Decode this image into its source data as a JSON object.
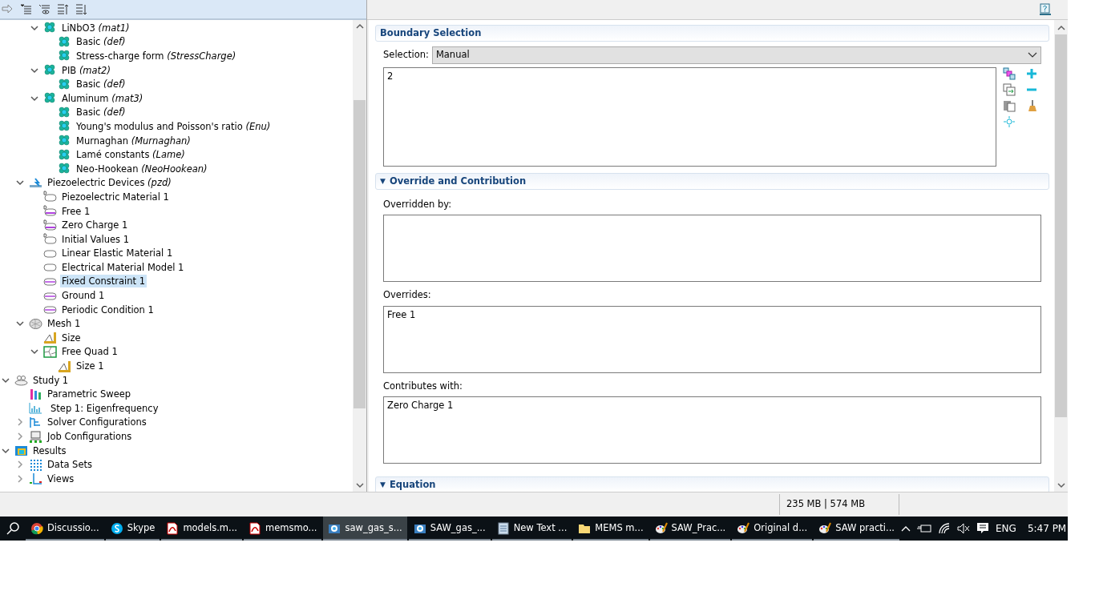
{
  "tree": [
    {
      "children": [
        {
          "children": [
            {
              "label": "LiNbO3 *(mat1)*",
              "kind": "material",
              "expanded": true,
              "selected": false,
              "children": [
                {
                  "label": "Basic *(def)*",
                  "kind": "material",
                  "selected": false
                },
                {
                  "label": "Stress-charge form *(StressCharge)*",
                  "kind": "material",
                  "selected": false
                }
              ]
            },
            {
              "label": "PIB *(mat2)*",
              "kind": "material",
              "expanded": true,
              "selected": false,
              "children": [
                {
                  "label": "Basic *(def)*",
                  "kind": "material",
                  "selected": false
                }
              ]
            },
            {
              "label": "Aluminum *(mat3)*",
              "kind": "material",
              "expanded": true,
              "selected": false,
              "children": [
                {
                  "label": "Basic *(def)*",
                  "kind": "material",
                  "selected": false
                },
                {
                  "label": "Young's modulus and Poisson's ratio *(Enu)*",
                  "kind": "material",
                  "selected": false
                },
                {
                  "label": "Murnaghan *(Murnaghan)*",
                  "kind": "material",
                  "selected": false
                },
                {
                  "label": "Lamé constants *(Lame)*",
                  "kind": "material",
                  "selected": false
                },
                {
                  "label": "Neo-Hookean *(NeoHookean)*",
                  "kind": "material",
                  "selected": false
                }
              ]
            }
          ]
        },
        {
          "label": "Piezoelectric Devices *(pzd)*",
          "kind": "physics",
          "expanded": true,
          "selected": false,
          "children": [
            {
              "label": "Piezoelectric Material 1",
              "kind": "default",
              "selected": false
            },
            {
              "label": "Free 1",
              "kind": "default-boundary",
              "selected": false
            },
            {
              "label": "Zero Charge 1",
              "kind": "default-boundary",
              "selected": false
            },
            {
              "label": "Initial Values 1",
              "kind": "default",
              "selected": false
            },
            {
              "label": "Linear Elastic Material 1",
              "kind": "domain",
              "selected": false
            },
            {
              "label": "Electrical Material Model 1",
              "kind": "domain",
              "selected": false
            },
            {
              "label": "Fixed Constraint 1",
              "kind": "boundary",
              "selected": true
            },
            {
              "label": "Ground 1",
              "kind": "boundary",
              "selected": false
            },
            {
              "label": "Periodic Condition 1",
              "kind": "boundary",
              "selected": false
            }
          ]
        },
        {
          "label": "Mesh 1",
          "kind": "mesh",
          "expanded": true,
          "selected": false,
          "children": [
            {
              "label": "Size",
              "kind": "size",
              "selected": false
            },
            {
              "label": "Free Quad 1",
              "kind": "quad",
              "expanded": true,
              "selected": false,
              "children": [
                {
                  "label": "Size 1",
                  "kind": "size",
                  "selected": false
                }
              ]
            }
          ]
        }
      ]
    },
    {
      "label": "Study 1",
      "kind": "study",
      "expanded": true,
      "selected": false,
      "children": [
        {
          "label": "Parametric Sweep",
          "kind": "sweep",
          "selected": false
        },
        {
          "label": "Step 1: Eigenfrequency",
          "kind": "step",
          "selected": false
        },
        {
          "label": "Solver Configurations",
          "kind": "solver",
          "expanded": false,
          "selected": false
        },
        {
          "label": "Job Configurations",
          "kind": "job",
          "expanded": false,
          "selected": false
        }
      ]
    },
    {
      "label": "Results",
      "kind": "results",
      "expanded": true,
      "selected": false,
      "children": [
        {
          "label": "Data Sets",
          "kind": "datasets",
          "expanded": false,
          "selected": false
        },
        {
          "label": "Views",
          "kind": "views",
          "expanded": false,
          "selected": false
        }
      ]
    }
  ],
  "sections": [
    {
      "title": "Boundary Selection",
      "selection_label": "Selection:",
      "selection_value": "Manual",
      "list_value": "2"
    },
    {
      "title": "Override and Contribution",
      "toggle": "▼",
      "lists": [
        {
          "label": "Overridden by:"
        },
        {
          "label": "Overrides:",
          "value": "Free 1"
        },
        {
          "label": "Contributes with:",
          "value": "Zero Charge 1"
        }
      ]
    },
    {
      "title": "Equation",
      "toggle": "▼"
    }
  ],
  "status_bar": {
    "memory": "235 MB | 574 MB"
  },
  "taskbar": {
    "apps": [
      {
        "label": "Discussio...",
        "kind": "chrome",
        "selected": false
      },
      {
        "label": "Skype",
        "kind": "skype",
        "selected": false
      },
      {
        "label": "models.m...",
        "kind": "pdf",
        "selected": false
      },
      {
        "label": "memsmo...",
        "kind": "pdf",
        "selected": false
      },
      {
        "label": "saw_gas_s...",
        "kind": "comsol",
        "selected": true
      },
      {
        "label": "SAW_gas_...",
        "kind": "comsol",
        "selected": false
      },
      {
        "label": "New Text ...",
        "kind": "notepad",
        "selected": false
      },
      {
        "label": "MEMS m...",
        "kind": "folder",
        "selected": false
      },
      {
        "label": "SAW_Prac...",
        "kind": "paint",
        "selected": false
      },
      {
        "label": "Original d...",
        "kind": "paint",
        "selected": false
      },
      {
        "label": "SAW practi...",
        "kind": "paint",
        "selected": false
      }
    ],
    "language": "ENG",
    "time": "5:47 PM"
  }
}
